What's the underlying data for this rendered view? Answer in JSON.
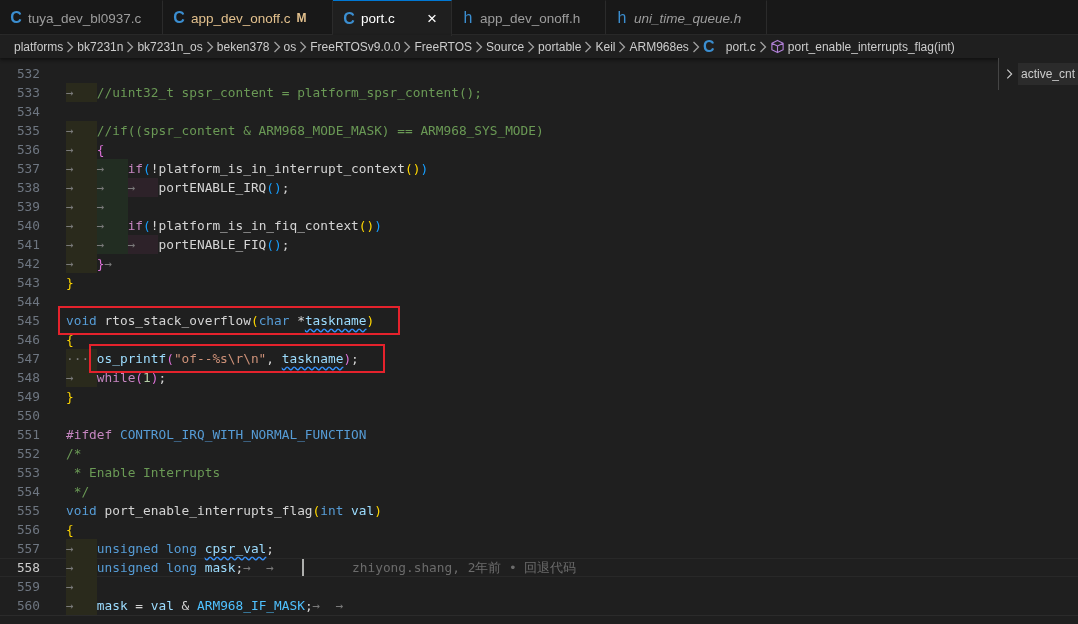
{
  "tabs": [
    {
      "icon": "C",
      "label": "tuya_dev_bl0937.c",
      "selected": false,
      "modified": false,
      "preview": false
    },
    {
      "icon": "C",
      "label": "app_dev_onoff.c",
      "selected": false,
      "modified": true,
      "badge": "M",
      "preview": false
    },
    {
      "icon": "C",
      "label": "port.c",
      "selected": true,
      "modified": false,
      "preview": false,
      "close": "×"
    },
    {
      "icon": "h",
      "label": "app_dev_onoff.h",
      "selected": false,
      "modified": false,
      "preview": false
    },
    {
      "icon": "h",
      "label": "uni_time_queue.h",
      "selected": false,
      "modified": false,
      "preview": true
    }
  ],
  "breadcrumbs": [
    {
      "kind": "folder",
      "label": "platforms"
    },
    {
      "kind": "folder",
      "label": "bk7231n"
    },
    {
      "kind": "folder",
      "label": "bk7231n_os"
    },
    {
      "kind": "folder",
      "label": "beken378"
    },
    {
      "kind": "folder",
      "label": "os"
    },
    {
      "kind": "folder",
      "label": "FreeRTOSv9.0.0"
    },
    {
      "kind": "folder",
      "label": "FreeRTOS"
    },
    {
      "kind": "folder",
      "label": "Source"
    },
    {
      "kind": "folder",
      "label": "portable"
    },
    {
      "kind": "folder",
      "label": "Keil"
    },
    {
      "kind": "folder",
      "label": "ARM968es"
    },
    {
      "kind": "file",
      "icon": "C",
      "label": "port.c"
    },
    {
      "kind": "symbol",
      "label": "port_enable_interrupts_flag(int)"
    }
  ],
  "peek": {
    "value": "active_cnt"
  },
  "lines": [
    {
      "number": "532",
      "current": false,
      "boxed": false
    },
    {
      "number": "533",
      "current": false,
      "boxed": false,
      "indent": [
        "→"
      ],
      "tokens": [
        {
          "kind": "cm",
          "t": "//uint32_t spsr_content = platform_spsr_content();"
        }
      ]
    },
    {
      "number": "534",
      "current": false,
      "boxed": false
    },
    {
      "number": "535",
      "current": false,
      "boxed": false,
      "indent": [
        "→"
      ],
      "tokens": [
        {
          "kind": "cm",
          "t": "//if((spsr_content & ARM968_MODE_MASK) == ARM968_SYS_MODE)"
        }
      ]
    },
    {
      "number": "536",
      "current": false,
      "boxed": false,
      "indent": [
        "→"
      ],
      "tokens": [
        {
          "kind": "b2",
          "t": "{"
        }
      ]
    },
    {
      "number": "537",
      "current": false,
      "boxed": false,
      "indent": [
        "→",
        "→"
      ],
      "tokens": [
        {
          "kind": "ctl",
          "t": "if"
        },
        {
          "kind": "b3",
          "t": "("
        },
        {
          "kind": "pl",
          "t": "!platform_is_in_interrupt_context"
        },
        {
          "kind": "b1",
          "t": "()"
        },
        {
          "kind": "b3",
          "t": ")"
        }
      ]
    },
    {
      "number": "538",
      "current": false,
      "boxed": false,
      "indent": [
        "→",
        "→",
        "→"
      ],
      "tokens": [
        {
          "kind": "pl",
          "t": "portENABLE_IRQ"
        },
        {
          "kind": "b3",
          "t": "()"
        },
        {
          "kind": "pl",
          "t": ";"
        }
      ]
    },
    {
      "number": "539",
      "current": false,
      "boxed": false,
      "indent": [
        "→",
        "→"
      ]
    },
    {
      "number": "540",
      "current": false,
      "boxed": false,
      "indent": [
        "→",
        "→"
      ],
      "tokens": [
        {
          "kind": "ctl",
          "t": "if"
        },
        {
          "kind": "b3",
          "t": "("
        },
        {
          "kind": "pl",
          "t": "!platform_is_in_fiq_context"
        },
        {
          "kind": "b1",
          "t": "()"
        },
        {
          "kind": "b3",
          "t": ")"
        }
      ]
    },
    {
      "number": "541",
      "current": false,
      "boxed": false,
      "indent": [
        "→",
        "→",
        "→"
      ],
      "tokens": [
        {
          "kind": "pl",
          "t": "portENABLE_FIQ"
        },
        {
          "kind": "b3",
          "t": "()"
        },
        {
          "kind": "pl",
          "t": ";"
        }
      ]
    },
    {
      "number": "542",
      "current": false,
      "boxed": false,
      "indent": [
        "→"
      ],
      "tokens": [
        {
          "kind": "b2",
          "t": "}"
        }
      ],
      "trail": "→"
    },
    {
      "number": "543",
      "current": false,
      "boxed": false,
      "tokens": [
        {
          "kind": "b1",
          "t": "}"
        }
      ]
    },
    {
      "number": "544",
      "current": false,
      "boxed": false
    },
    {
      "number": "545",
      "current": false,
      "boxed": true,
      "tokens": [
        {
          "kind": "kw",
          "t": "void"
        },
        {
          "kind": "pl",
          "t": " rtos_stack_overflow"
        },
        {
          "kind": "b1",
          "t": "("
        },
        {
          "kind": "kw",
          "t": "char"
        },
        {
          "kind": "pl",
          "t": " *"
        },
        {
          "kind": "var-warn",
          "t": "taskname"
        },
        {
          "kind": "b1",
          "t": ")"
        }
      ]
    },
    {
      "number": "546",
      "current": false,
      "boxed": false,
      "tokens": [
        {
          "kind": "b1",
          "t": "{"
        }
      ]
    },
    {
      "number": "547",
      "current": false,
      "boxed": true,
      "indent": [
        "···"
      ],
      "tokens": [
        {
          "kind": "var",
          "t": "os_printf"
        },
        {
          "kind": "b2",
          "t": "("
        },
        {
          "kind": "str",
          "t": "\"of--%s\\r\\n\""
        },
        {
          "kind": "pl",
          "t": ", "
        },
        {
          "kind": "var-warn",
          "t": "taskname"
        },
        {
          "kind": "b2",
          "t": ")"
        },
        {
          "kind": "pl",
          "t": ";"
        }
      ]
    },
    {
      "number": "548",
      "current": false,
      "boxed": false,
      "indent": [
        "→"
      ],
      "tokens": [
        {
          "kind": "ctl",
          "t": "while"
        },
        {
          "kind": "b2",
          "t": "("
        },
        {
          "kind": "num",
          "t": "1"
        },
        {
          "kind": "b2",
          "t": ")"
        },
        {
          "kind": "pl",
          "t": ";"
        }
      ]
    },
    {
      "number": "549",
      "current": false,
      "boxed": false,
      "tokens": [
        {
          "kind": "b1",
          "t": "}"
        }
      ]
    },
    {
      "number": "550",
      "current": false,
      "boxed": false
    },
    {
      "number": "551",
      "current": false,
      "boxed": false,
      "tokens": [
        {
          "kind": "ctl",
          "t": "#ifdef"
        },
        {
          "kind": "kw",
          "t": " CONTROL_IRQ_WITH_NORMAL_FUNCTION"
        }
      ]
    },
    {
      "number": "552",
      "current": false,
      "boxed": false,
      "tokens": [
        {
          "kind": "cm",
          "t": "/*"
        }
      ]
    },
    {
      "number": "553",
      "current": false,
      "boxed": false,
      "tokens": [
        {
          "kind": "cm",
          "t": " * Enable Interrupts"
        }
      ]
    },
    {
      "number": "554",
      "current": false,
      "boxed": false,
      "tokens": [
        {
          "kind": "cm",
          "t": " */"
        }
      ]
    },
    {
      "number": "555",
      "current": false,
      "boxed": false,
      "tokens": [
        {
          "kind": "kw",
          "t": "void"
        },
        {
          "kind": "pl",
          "t": " port_enable_interrupts_flag"
        },
        {
          "kind": "b1",
          "t": "("
        },
        {
          "kind": "kw",
          "t": "int"
        },
        {
          "kind": "var",
          "t": " val"
        },
        {
          "kind": "b1",
          "t": ")"
        }
      ]
    },
    {
      "number": "556",
      "current": false,
      "boxed": false,
      "tokens": [
        {
          "kind": "b1",
          "t": "{"
        }
      ]
    },
    {
      "number": "557",
      "current": false,
      "boxed": false,
      "indent": [
        "→"
      ],
      "tokens": [
        {
          "kind": "kw",
          "t": "unsigned long "
        },
        {
          "kind": "var-warn",
          "t": "cpsr_val"
        },
        {
          "kind": "pl",
          "t": ";"
        }
      ]
    },
    {
      "number": "558",
      "current": true,
      "boxed": false,
      "indent": [
        "→"
      ],
      "tokens": [
        {
          "kind": "kw",
          "t": "unsigned long"
        },
        {
          "kind": "var",
          "t": " mask"
        },
        {
          "kind": "pl",
          "t": ";"
        }
      ],
      "trail": "→  →",
      "blame": "zhiyong.shang, 2年前 • 回退代码"
    },
    {
      "number": "559",
      "current": false,
      "boxed": false,
      "indent": [
        "→"
      ]
    },
    {
      "number": "560",
      "current": false,
      "boxed": false,
      "indent": [
        "→"
      ],
      "tokens": [
        {
          "kind": "var",
          "t": "mask"
        },
        {
          "kind": "pl",
          "t": " = "
        },
        {
          "kind": "var",
          "t": "val"
        },
        {
          "kind": "pl",
          "t": " & "
        },
        {
          "kind": "mac",
          "t": "ARM968_IF_MASK"
        },
        {
          "kind": "pl",
          "t": ";"
        }
      ],
      "trail": "→  →"
    }
  ]
}
